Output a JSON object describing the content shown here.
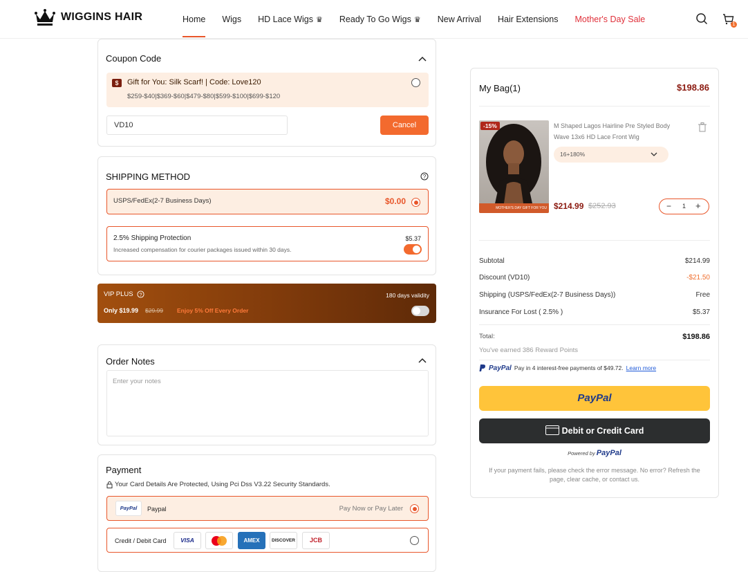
{
  "header": {
    "brand": "WIGGINS HAIR",
    "nav": [
      {
        "label": "Home",
        "crown": false
      },
      {
        "label": "Wigs",
        "crown": false
      },
      {
        "label": "HD Lace Wigs",
        "crown": true
      },
      {
        "label": "Ready To Go Wigs",
        "crown": true
      },
      {
        "label": "New Arrival",
        "crown": false
      },
      {
        "label": "Hair Extensions",
        "crown": false
      },
      {
        "label": "Mother's Day Sale",
        "crown": false
      }
    ],
    "cart_count": "1",
    "accent_color": "#e8562a"
  },
  "coupon": {
    "title": "Coupon Code",
    "offer_title": "Gift for You: Silk Scarf! | Code: Love120",
    "offer_tiers": "$259-$40|$369-$60|$479-$80|$599-$100|$699-$120",
    "input_value": "VD10",
    "cancel_label": "Cancel"
  },
  "shipping": {
    "title": "SHIPPING METHOD",
    "option_label": "USPS/FedEx(2-7 Business Days)",
    "option_price": "$0.00",
    "protection_title": "2.5% Shipping Protection",
    "protection_desc": "Increased compensation for courier packages issued within 30 days.",
    "protection_price": "$5.37",
    "protection_enabled": true
  },
  "vip": {
    "title": "VIP PLUS",
    "validity": "180 days validity",
    "price": "Only $19.99",
    "old_price": "$29.99",
    "promo": "Enjoy 5% Off Every Order",
    "enabled": false
  },
  "notes": {
    "title": "Order Notes",
    "placeholder": "Enter your notes"
  },
  "payment": {
    "title": "Payment",
    "security": "Your Card Details Are Protected, Using Pci Dss V3.22 Security Standards.",
    "paypal_label": "Paypal",
    "paypal_logo": "PayPal",
    "paypal_hint": "Pay Now or Pay Later",
    "card_label": "Credit / Debit Card",
    "card_brands": [
      "VISA",
      "Mastercard",
      "AMEX",
      "DISCOVER",
      "JCB"
    ]
  },
  "bag": {
    "title": "My Bag(1)",
    "total_top": "$198.86",
    "product": {
      "discount_badge": "-15%",
      "name": "M Shaped Lagos Hairline Pre Styled Body Wave 13x6 HD Lace Front Wig",
      "variant": "16+180%",
      "price": "$214.99",
      "old_price": "$252.93",
      "quantity": "1",
      "banner": "MOTHER'S DAY GIFT FOR YOU"
    },
    "summary": [
      {
        "label": "Subtotal",
        "value": "$214.99"
      },
      {
        "label": "Discount (VD10)",
        "value": "-$21.50"
      },
      {
        "label": "Shipping (USPS/FedEx(2-7 Business Days))",
        "value": "Free"
      },
      {
        "label": "Insurance For Lost ( 2.5% )",
        "value": "$5.37"
      }
    ],
    "total_label": "Total:",
    "total_value": "$198.86",
    "reward": "You've earned 386 Reward Points",
    "paylater_text": "Pay in 4 interest-free payments of $49.72.",
    "learn_more": "Learn more",
    "paypal_button": "PayPal",
    "card_button": "Debit or Credit Card",
    "powered_by": "Powered by",
    "powered_brand": "PayPal",
    "error_note": "If your payment fails, please check the error message. No error? Refresh the page, clear cache, or contact us."
  }
}
